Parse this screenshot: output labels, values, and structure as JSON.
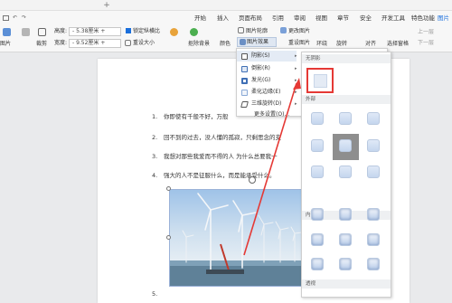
{
  "titlebar": {
    "new_tab": "+"
  },
  "menubar": {
    "items": [
      "开始",
      "插入",
      "页面布局",
      "引用",
      "审阅",
      "视图",
      "章节",
      "安全",
      "开发工具",
      "特色功能"
    ],
    "active_index": 10,
    "active_label": "图片工具"
  },
  "ribbon": {
    "height_label": "高度:",
    "height_value": "- 5.38厘米 +",
    "width_label": "宽度:",
    "width_value": "- 9.52厘米 +",
    "lock_ratio": "锁定纵横比",
    "reset_size": "重设大小",
    "crop": "裁剪",
    "remove_bg": "抠除背景",
    "color": "颜色",
    "picture_outline": "图片轮廓",
    "picture_effects": "图片效果",
    "change_picture": "更改图片",
    "reset_picture": "重设图片",
    "wrap": "环绕",
    "rotate": "旋转",
    "align": "对齐",
    "select_pane": "选择窗格",
    "prev_layer": "上一层",
    "next_layer": "下一层",
    "picture": "图片"
  },
  "effects_menu": {
    "items": [
      {
        "label": "阴影(S)",
        "icon": "shadow-icon"
      },
      {
        "label": "倒影(R)",
        "icon": "reflection-icon"
      },
      {
        "label": "发光(G)",
        "icon": "glow-icon"
      },
      {
        "label": "柔化边缘(E)",
        "icon": "soft-edge-icon"
      },
      {
        "label": "三维旋转(D)",
        "icon": "3d-rotate-icon"
      }
    ],
    "more": "更多设置(O)..."
  },
  "shadow_gallery": {
    "none_header": "无阴影",
    "outer_header": "外部",
    "inner_header": "内部",
    "perspective_header": "透视"
  },
  "document": {
    "paragraphs": [
      {
        "num": "1.",
        "text": "你即使有千般不好，万般"
      },
      {
        "num": "2.",
        "text": "回不到的过去，没人懂的孤寂，只剩思念的支"
      },
      {
        "num": "3.",
        "text": "我想对那些我爱而不得的人 为什么总要我一"
      },
      {
        "num": "4.",
        "text": "强大的人不是征服什么，而是能承受什么。"
      }
    ],
    "bottom_num": "5."
  },
  "colors": {
    "accent": "#1a6fdc",
    "annotation": "#e53935"
  }
}
